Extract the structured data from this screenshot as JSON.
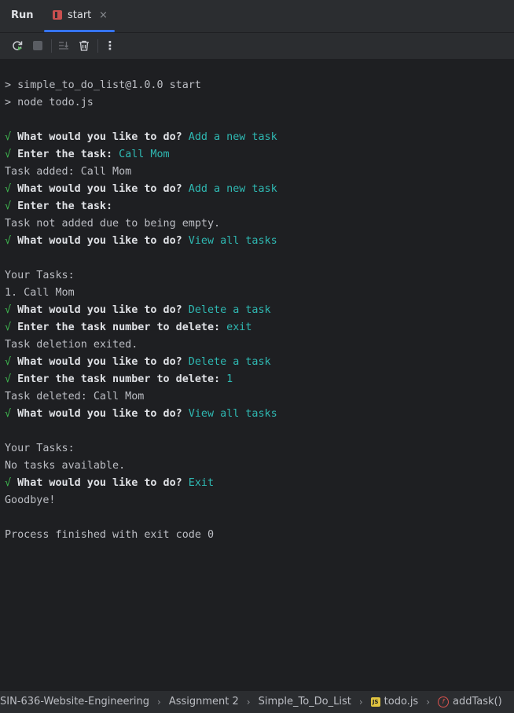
{
  "run_panel": {
    "title": "Run",
    "tab": {
      "label": "start",
      "close_glyph": "×",
      "icon": "npm-icon",
      "accent": "#3574f0"
    }
  },
  "toolbar": {
    "buttons": [
      {
        "name": "rerun-icon"
      },
      {
        "name": "stop-icon"
      },
      {
        "name": "scroll-to-end-icon"
      },
      {
        "name": "clear-all-icon"
      },
      {
        "name": "more-options-icon",
        "glyph": "⋮"
      }
    ]
  },
  "console": {
    "colors": {
      "check": "#3fb950",
      "answer": "#2fb9b3",
      "text": "#bcbec4"
    },
    "lines": [
      {
        "type": "text",
        "text": "> simple_to_do_list@1.0.0 start"
      },
      {
        "type": "text",
        "text": "> node todo.js"
      },
      {
        "type": "blank"
      },
      {
        "type": "prompt",
        "check": "√",
        "question": "What would you like to do?",
        "answer": "Add a new task"
      },
      {
        "type": "prompt",
        "check": "√",
        "question": "Enter the task:",
        "answer": "Call Mom"
      },
      {
        "type": "text",
        "text": "Task added: Call Mom"
      },
      {
        "type": "prompt",
        "check": "√",
        "question": "What would you like to do?",
        "answer": "Add a new task"
      },
      {
        "type": "prompt",
        "check": "√",
        "question": "Enter the task:",
        "answer": ""
      },
      {
        "type": "text",
        "text": "Task not added due to being empty."
      },
      {
        "type": "prompt",
        "check": "√",
        "question": "What would you like to do?",
        "answer": "View all tasks"
      },
      {
        "type": "blank"
      },
      {
        "type": "text",
        "text": "Your Tasks:"
      },
      {
        "type": "text",
        "text": "1. Call Mom"
      },
      {
        "type": "prompt",
        "check": "√",
        "question": "What would you like to do?",
        "answer": "Delete a task"
      },
      {
        "type": "prompt",
        "check": "√",
        "question": "Enter the task number to delete:",
        "answer": "exit"
      },
      {
        "type": "text",
        "text": "Task deletion exited."
      },
      {
        "type": "prompt",
        "check": "√",
        "question": "What would you like to do?",
        "answer": "Delete a task"
      },
      {
        "type": "prompt",
        "check": "√",
        "question": "Enter the task number to delete:",
        "answer": "1"
      },
      {
        "type": "text",
        "text": "Task deleted: Call Mom"
      },
      {
        "type": "prompt",
        "check": "√",
        "question": "What would you like to do?",
        "answer": "View all tasks"
      },
      {
        "type": "blank"
      },
      {
        "type": "text",
        "text": "Your Tasks:"
      },
      {
        "type": "text",
        "text": "No tasks available."
      },
      {
        "type": "prompt",
        "check": "√",
        "question": "What would you like to do?",
        "answer": "Exit"
      },
      {
        "type": "text",
        "text": "Goodbye!"
      },
      {
        "type": "blank"
      },
      {
        "type": "text",
        "text": "Process finished with exit code 0"
      }
    ]
  },
  "breadcrumbs": [
    {
      "label": "SIN-636-Website-Engineering"
    },
    {
      "label": "Assignment 2"
    },
    {
      "label": "Simple_To_Do_List"
    },
    {
      "label": "todo.js",
      "icon": "js-file-icon",
      "icon_text": "JS"
    },
    {
      "label": "addTask()",
      "icon": "function-icon",
      "icon_text": "f"
    }
  ],
  "breadcrumb_separator": "›"
}
